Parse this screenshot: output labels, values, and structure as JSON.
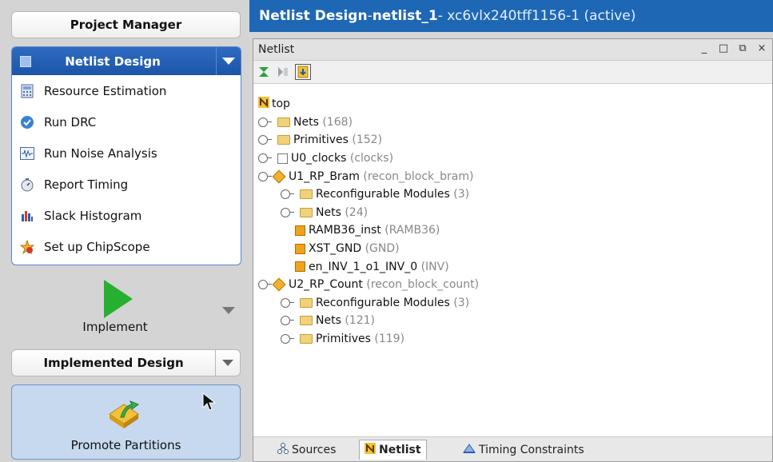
{
  "left_panel": {
    "project_manager": "Project Manager",
    "netlist_design": {
      "header": "Netlist Design",
      "items": [
        {
          "label": "Resource Estimation",
          "icon": "calculator-icon"
        },
        {
          "label": "Run DRC",
          "icon": "checkmark-circle-icon"
        },
        {
          "label": "Run Noise Analysis",
          "icon": "waveform-icon"
        },
        {
          "label": "Report Timing",
          "icon": "stopwatch-icon"
        },
        {
          "label": "Slack Histogram",
          "icon": "histogram-icon"
        },
        {
          "label": "Set up ChipScope",
          "icon": "chipscope-icon"
        }
      ]
    },
    "implement": "Implement",
    "implemented_design": "Implemented Design",
    "promote_partitions": "Promote Partitions"
  },
  "title": {
    "view": "Netlist Design",
    "separator": " - ",
    "netlist_name": "netlist_1",
    "device": " - xc6vlx240tff1156-1 (active)"
  },
  "netlist_window": {
    "title": "Netlist",
    "controls": [
      "_",
      "□",
      "⧉",
      "×"
    ],
    "tree": {
      "root": "top",
      "nets": {
        "label": "Nets",
        "count": "(168)"
      },
      "primitives": {
        "label": "Primitives",
        "count": "(152)"
      },
      "u0": {
        "label": "U0_clocks",
        "type": "(clocks)"
      },
      "u1": {
        "label": "U1_RP_Bram",
        "type": "(recon_block_bram)"
      },
      "u1_modules": {
        "label": "Reconfigurable Modules",
        "count": "(3)"
      },
      "u1_nets": {
        "label": "Nets",
        "count": "(24)"
      },
      "u1_ramb": {
        "label": "RAMB36_inst",
        "type": "(RAMB36)"
      },
      "u1_gnd": {
        "label": "XST_GND",
        "type": "(GND)"
      },
      "u1_inv": {
        "label": "en_INV_1_o1_INV_0",
        "type": "(INV)"
      },
      "u2": {
        "label": "U2_RP_Count",
        "type": "(recon_block_count)"
      },
      "u2_modules": {
        "label": "Reconfigurable Modules",
        "count": "(3)"
      },
      "u2_nets": {
        "label": "Nets",
        "count": "(121)"
      },
      "u2_prims": {
        "label": "Primitives",
        "count": "(119)"
      }
    }
  },
  "bottom_tabs": {
    "sources": "Sources",
    "netlist": "Netlist",
    "timing": "Timing Constraints"
  }
}
